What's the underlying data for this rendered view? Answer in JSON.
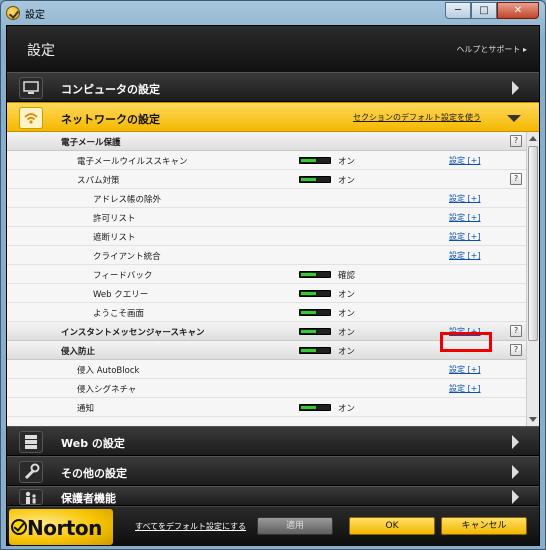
{
  "window": {
    "title": "設定",
    "buttons": {
      "minimize": "─",
      "maximize": "□",
      "close": "✕"
    }
  },
  "header": {
    "title": "設定",
    "help": "ヘルプとサポート ▸"
  },
  "sections": [
    {
      "label": "コンピュータの設定",
      "icon": "monitor-icon"
    },
    {
      "label": "ネットワークの設定",
      "icon": "wifi-icon",
      "link": "セクションのデフォルト設定を使う"
    },
    {
      "label": "Web の設定",
      "icon": "server-icon"
    },
    {
      "label": "その他の設定",
      "icon": "wrench-icon"
    },
    {
      "label": "保護者機能",
      "icon": "family-icon"
    }
  ],
  "rows": [
    {
      "label": "電子メール保護",
      "group": true,
      "help": "?"
    },
    {
      "label": "電子メールウイルススキャン",
      "toggle": "オン",
      "config": "設定 [+]"
    },
    {
      "label": "スパム対策",
      "toggle": "オン",
      "help": "?"
    },
    {
      "label": "アドレス帳の除外",
      "config": "設定 [+]"
    },
    {
      "label": "許可リスト",
      "config": "設定 [+]"
    },
    {
      "label": "遮断リスト",
      "config": "設定 [+]"
    },
    {
      "label": "クライアント統合",
      "config": "設定 [+]"
    },
    {
      "label": "フィードバック",
      "toggle": "確認"
    },
    {
      "label": "Web クエリー",
      "toggle": "オン"
    },
    {
      "label": "ようこそ画面",
      "toggle": "オン"
    },
    {
      "label": "インスタントメッセンジャースキャン",
      "group": true,
      "toggle": "オン",
      "config": "設定 [+]",
      "help": "?"
    },
    {
      "label": "侵入防止",
      "group": true,
      "toggle": "オン",
      "help": "?"
    },
    {
      "label": "侵入 AutoBlock",
      "config": "設定 [+]"
    },
    {
      "label": "侵入シグネチャ",
      "config": "設定 [+]"
    },
    {
      "label": "通知",
      "toggle": "オン"
    }
  ],
  "footer": {
    "logo": "Norton",
    "reset_link": "すべてをデフォルト設定にする",
    "apply": "適用",
    "ok": "OK",
    "cancel": "キャンセル"
  }
}
